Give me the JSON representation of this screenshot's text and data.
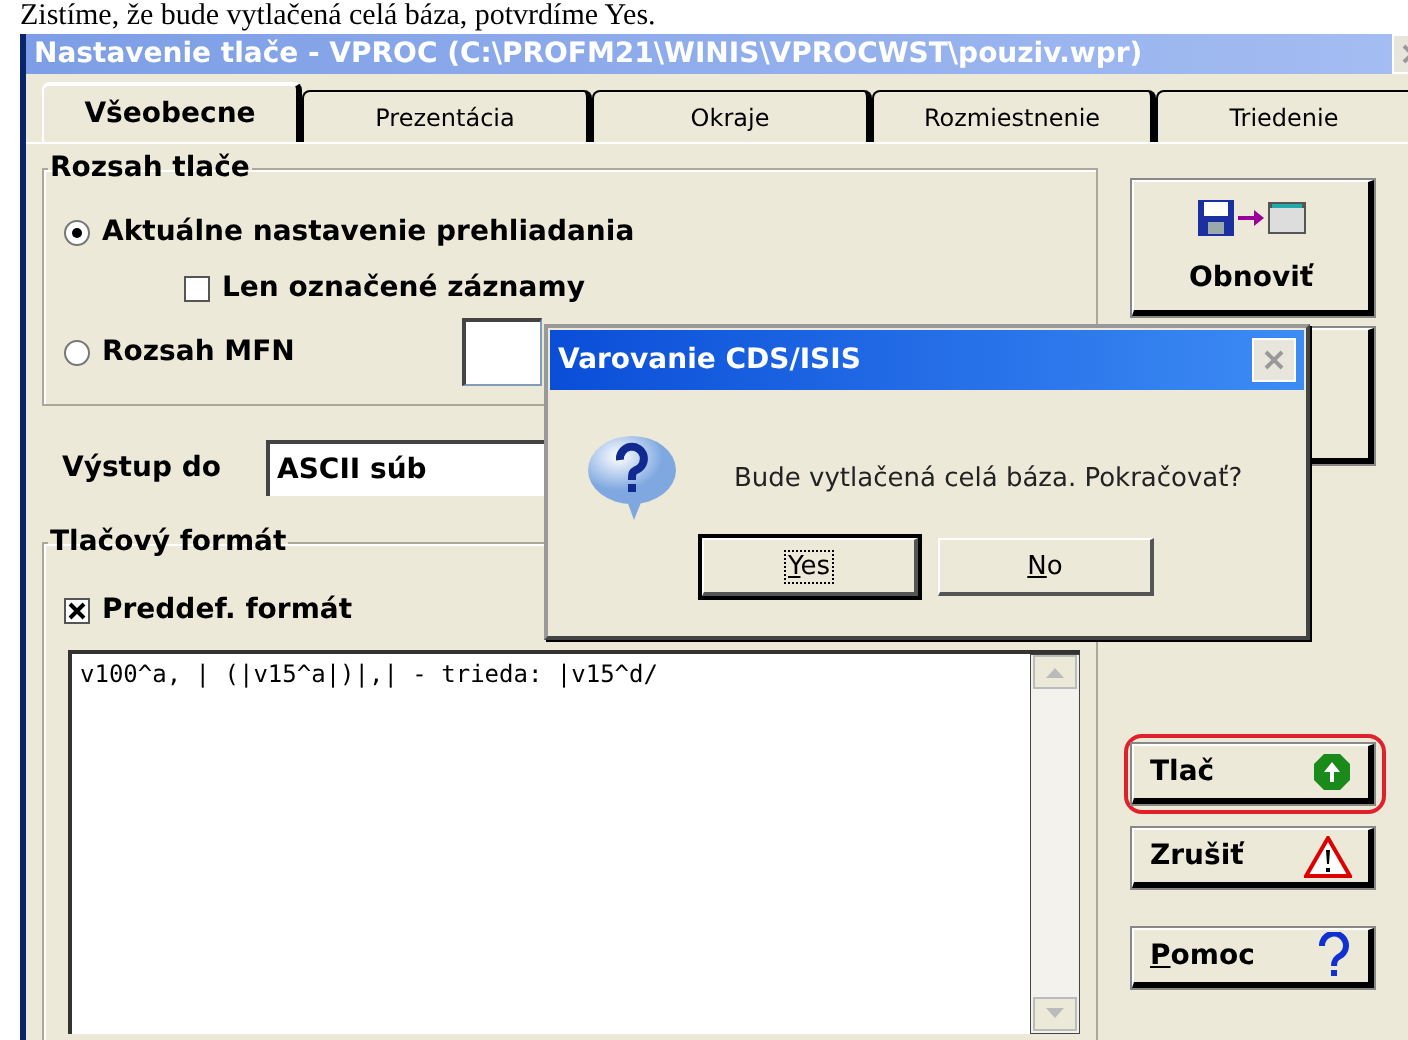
{
  "caption": "Zistíme, že bude vytlačená celá báza, potvrdíme Yes.",
  "window": {
    "title": "Nastavenie tlače - VPROC (C:\\PROFM21\\WINIS\\VPROCWST\\pouziv.wpr)"
  },
  "tabs": [
    {
      "label": "Všeobecne",
      "selected": true
    },
    {
      "label": "Prezentácia",
      "selected": false
    },
    {
      "label": "Okraje",
      "selected": false
    },
    {
      "label": "Rozmiestnenie",
      "selected": false
    },
    {
      "label": "Triedenie",
      "selected": false
    }
  ],
  "range_group": {
    "title": "Rozsah tlače",
    "options": [
      {
        "kind": "radio",
        "label": "Aktuálne nastavenie prehliadania",
        "selected": true
      },
      {
        "kind": "checkbox",
        "label": "Len označené záznamy",
        "checked": false
      },
      {
        "kind": "radio_field",
        "label": "Rozsah MFN",
        "selected": false
      }
    ]
  },
  "output": {
    "label": "Výstup do",
    "value": "ASCII súb"
  },
  "format_group": {
    "title": "Tlačový formát",
    "predefined": {
      "label": "Preddef. formát",
      "checked": true
    },
    "text": "v100^a, | (|v15^a|)|,| - trieda: |v15^d/"
  },
  "side_buttons": [
    {
      "kind": "refresh",
      "label": "Obnoviť",
      "highlighted": false,
      "accelerator": false
    },
    {
      "kind": "blank",
      "highlighted": false
    },
    {
      "kind": "print",
      "label": "Tlač",
      "highlighted": true,
      "accelerator": false
    },
    {
      "kind": "cancel",
      "label": "Zrušiť",
      "highlighted": false,
      "accelerator": false
    },
    {
      "kind": "help",
      "label": "Pomoc",
      "highlighted": false,
      "accelerator": true
    }
  ],
  "dialog": {
    "title": "Varovanie CDS/ISIS",
    "message": "Bude vytlačená celá báza. Pokračovať?",
    "buttons": [
      {
        "label": "Yes",
        "focused": true,
        "accelerator": true
      },
      {
        "label": "No",
        "focused": false,
        "accelerator": true
      }
    ]
  }
}
